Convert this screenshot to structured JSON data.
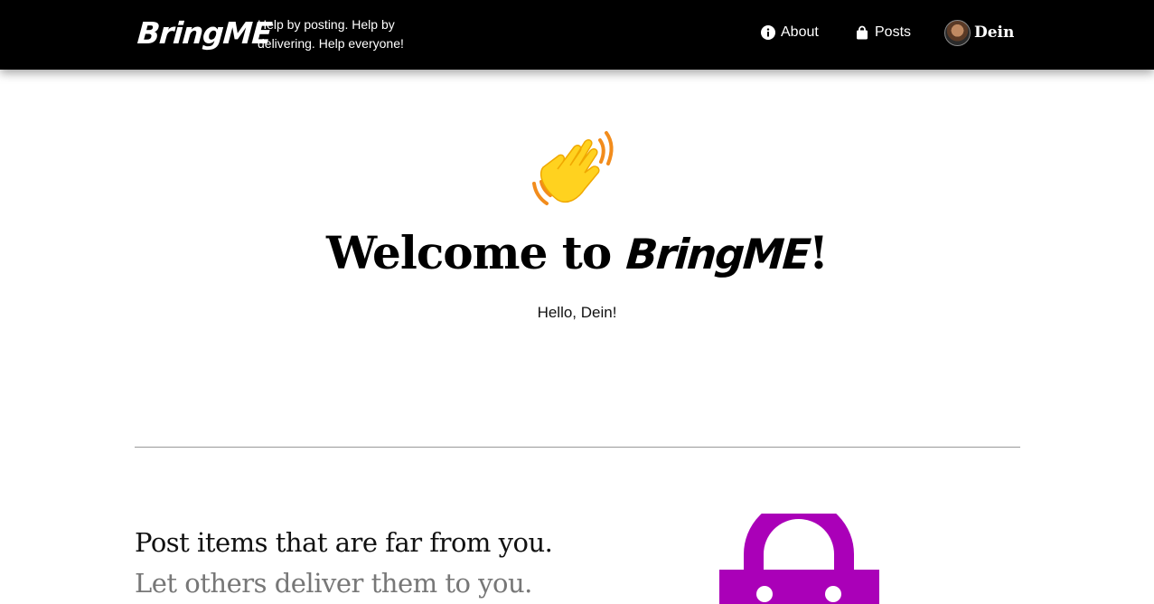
{
  "navbar": {
    "brand": "BringME",
    "tagline": "Help by posting. Help by delivering. Help everyone!",
    "links": {
      "about": {
        "label": "About",
        "icon": "info-circle-icon"
      },
      "posts": {
        "label": "Posts",
        "icon": "shopping-bag-icon"
      }
    },
    "user": {
      "name": "Dein"
    }
  },
  "hero": {
    "emoji": "👋",
    "welcome_prefix": "Welcome to",
    "welcome_brand": "BringME",
    "welcome_suffix": "!",
    "greeting": "Hello, Dein!"
  },
  "feature": {
    "title": "Post items that are far from you.",
    "subtitle": "Let others deliver them to you.",
    "graphic_icon": "shopping-bag-icon",
    "graphic_color": "#aa00b8"
  },
  "colors": {
    "navbar_bg": "#000000",
    "accent": "#aa00b8"
  }
}
